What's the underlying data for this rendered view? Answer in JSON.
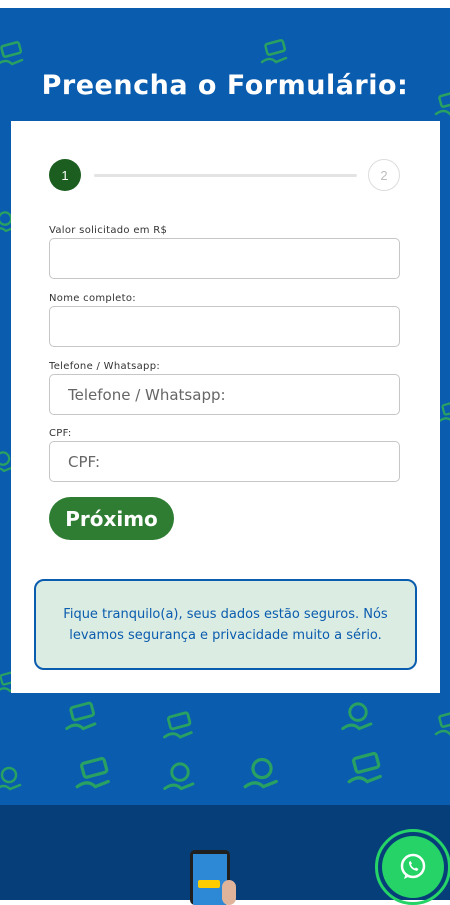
{
  "header": {
    "title": "Preencha o Formulário:"
  },
  "stepper": {
    "step1": "1",
    "step2": "2"
  },
  "form": {
    "valor_label": "Valor solicitado em R$",
    "valor_value": "",
    "nome_label": "Nome completo:",
    "nome_value": "",
    "telefone_label": "Telefone / Whatsapp:",
    "telefone_placeholder": "Telefone / Whatsapp:",
    "cpf_label": "CPF:",
    "cpf_placeholder": "CPF:",
    "next_button": "Próximo"
  },
  "notice": {
    "text": "Fique tranquilo(a), seus dados estão seguros. Nós levamos segurança e privacidade muito a sério."
  },
  "colors": {
    "background_blue": "#0a5cae",
    "footer_blue": "#063e7a",
    "step_active": "#1b5e20",
    "button_green": "#2e7d32",
    "whatsapp_green": "#25d366",
    "notice_bg": "#dbece3",
    "deco_green": "#2fae55"
  },
  "icons": {
    "background": "money-hand-icon",
    "whatsapp": "whatsapp-icon"
  }
}
